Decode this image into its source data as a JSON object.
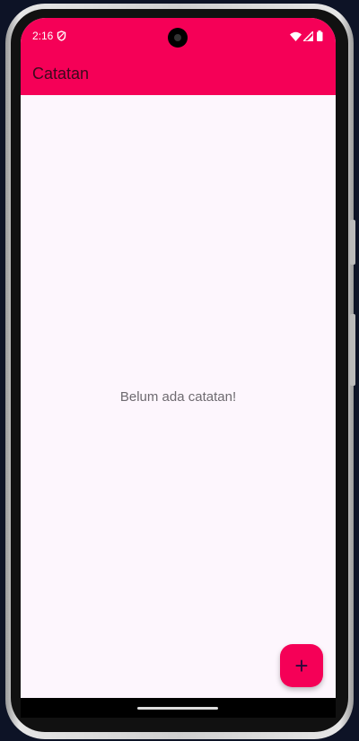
{
  "status_bar": {
    "time": "2:16",
    "icons": [
      "shield-icon",
      "wifi-icon",
      "signal-icon",
      "battery-icon"
    ]
  },
  "app_bar": {
    "title": "Catatan"
  },
  "main": {
    "empty_message": "Belum ada catatan!"
  },
  "fab": {
    "label": "+",
    "icon": "plus-icon"
  },
  "colors": {
    "primary": "#F50057",
    "background": "#FDF6FD"
  }
}
